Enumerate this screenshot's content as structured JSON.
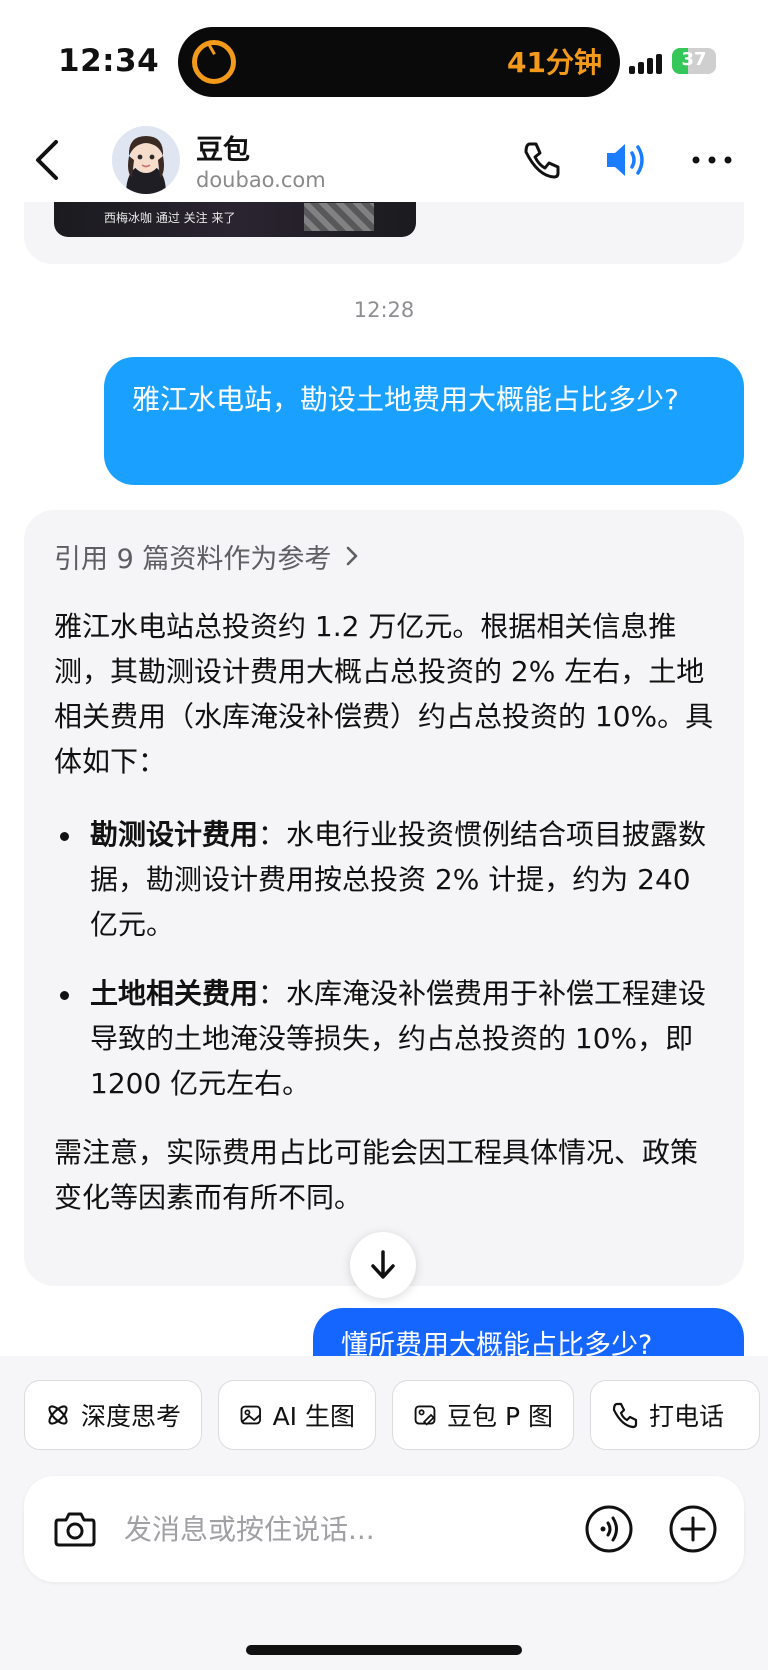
{
  "status_bar": {
    "time": "12:34",
    "island_text": "41分钟",
    "battery": "37",
    "battery_level": 0.37
  },
  "header": {
    "name": "豆包",
    "domain": "doubao.com"
  },
  "chat": {
    "prev_thumb_text": "西梅冰咖 通过 关注 来了",
    "timestamp": "12:28",
    "user_message": "雅江水电站，勘设土地费用大概能占比多少?",
    "ai": {
      "reference": "引用 9 篇资料作为参考",
      "intro": "雅江水电站总投资约 1.2 万亿元。根据相关信息推测，其勘测设计费用大概占总投资的 2% 左右，土地相关费用（水库淹没补偿费）约占总投资的 10%。具体如下：",
      "bullets": [
        {
          "title": "勘测设计费用",
          "text": "：水电行业投资惯例结合项目披露数据，勘测设计费用按总投资 2% 计提，约为 240 亿元。"
        },
        {
          "title": "土地相关费用",
          "text": "：水库淹没补偿费用于补偿工程建设导致的土地淹没等损失，约占总投资的 10%，即 1200 亿元左右。"
        }
      ],
      "note": "需注意，实际费用占比可能会因工程具体情况、政策变化等因素而有所不同。"
    },
    "user_message_2": "懂所费用大概能占比多少?"
  },
  "toolbar": {
    "chips": [
      {
        "label": "深度思考",
        "icon": "atom-icon"
      },
      {
        "label": "AI 生图",
        "icon": "image-icon"
      },
      {
        "label": "豆包 P 图",
        "icon": "photo-edit-icon"
      },
      {
        "label": "打电话",
        "icon": "phone-icon"
      }
    ],
    "input_placeholder": "发消息或按住说话..."
  },
  "colors": {
    "user_bubble": "#1aa1ff",
    "user_bubble_2": "#1565ff",
    "speaker_blue": "#1a7cff",
    "timer_orange": "#f39a1b"
  }
}
